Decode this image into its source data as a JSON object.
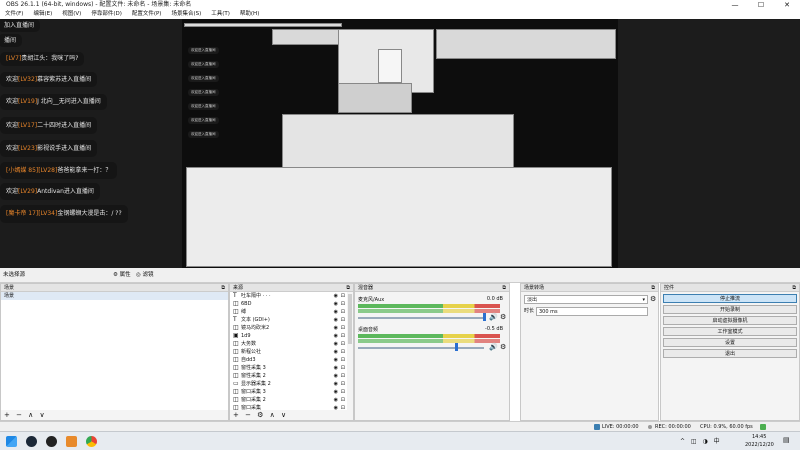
{
  "window": {
    "title": "OBS 26.1.1 (64-bit, windows) - 配置文件: 未命名 - 场景集: 未命名",
    "min": "—",
    "max": "☐",
    "close": "✕"
  },
  "menu": [
    "文件(F)",
    "编辑(E)",
    "视图(V)",
    "停靠部件(D)",
    "配置文件(P)",
    "场景集合(S)",
    "工具(T)",
    "帮助(H)"
  ],
  "chat": [
    {
      "pre": "",
      "lv": "",
      "post": "加入直播间"
    },
    {
      "pre": "",
      "lv": "",
      "post": "播间"
    },
    {
      "pre": "",
      "lv": "[LV7]",
      "post": "贵胡江头：我咪了吗?"
    },
    {
      "pre": "欢迎",
      "lv": "[LV32]",
      "post": "慕容紫苏进入直播间"
    },
    {
      "pre": "欢迎",
      "lv": "[LV19]",
      "post": "J 北向__无问进入直播间"
    },
    {
      "pre": "欢迎",
      "lv": "[LV17]",
      "post": "二十四时进入直播间"
    },
    {
      "pre": "欢迎",
      "lv": "[LV23]",
      "post": "影视说手进入直播间"
    },
    {
      "pre": "",
      "lv": "[小嫣媒 85][LV28]",
      "post": "爸爸能拿来一打：？"
    },
    {
      "pre": "欢迎",
      "lv": "[LV29]",
      "post": "Antdivan进入直播间"
    },
    {
      "pre": "",
      "lv": "[魔卡帝 17][LV34]",
      "post": "金钢螺蛳大漫是击：/ ??"
    }
  ],
  "scene_bar": {
    "label": "未选择源",
    "props": "⚙ 属性",
    "filters": "◎ 滤镜"
  },
  "docks": {
    "scenes": {
      "title": "场景",
      "pin": "⧉",
      "item": "场景",
      "footer": "+ − ∧ ∨"
    },
    "sources": {
      "title": "来源",
      "pin": "⧉",
      "footer": "+ − ⚙ ∧ ∨",
      "items": [
        {
          "icon": "T",
          "label": "吐车隔中 · · ·"
        },
        {
          "icon": "◫",
          "label": "6BD"
        },
        {
          "icon": "◫",
          "label": "缚"
        },
        {
          "icon": "T",
          "label": "文本 (GDI+)"
        },
        {
          "icon": "◫",
          "label": "镜马均砍米2"
        },
        {
          "icon": "▣",
          "label": "1d9"
        },
        {
          "icon": "◫",
          "label": "大务数"
        },
        {
          "icon": "◫",
          "label": "新程公社"
        },
        {
          "icon": "◫",
          "label": "自dd3"
        },
        {
          "icon": "◫",
          "label": "窗性采集 3"
        },
        {
          "icon": "◫",
          "label": "窗性采集 2"
        },
        {
          "icon": "▭",
          "label": "显示器采集 2"
        },
        {
          "icon": "◫",
          "label": "窗口采集 3"
        },
        {
          "icon": "◫",
          "label": "窗口采集 2"
        },
        {
          "icon": "◫",
          "label": "窗口采集"
        }
      ]
    },
    "mixer": {
      "title": "混音器",
      "pin": "⧉",
      "tracks": [
        {
          "name": "麦克风/Aux",
          "db": "0.0 dB"
        },
        {
          "name": "桌面音频",
          "db": "-0.5 dB"
        }
      ]
    },
    "transitions": {
      "title": "场景转场",
      "pin": "⧉",
      "selected": "淡出",
      "duration_label": "时长",
      "duration_value": "300 ms"
    },
    "controls": {
      "title": "控件",
      "pin": "⧉",
      "buttons": [
        "停止推流",
        "开始录制",
        "启动虚拟摄像机",
        "工作室模式",
        "设置",
        "退出"
      ]
    }
  },
  "status": {
    "live": "LIVE: 00:00:00",
    "rec": "REC: 00:00:00",
    "cpu": "CPU: 0.9%, 60.00 fps"
  },
  "taskbar": {
    "time": "14:45",
    "date": "2022/12/20",
    "tray": "^ ◫ ◑ 中",
    "notify": "▤"
  },
  "colors": {
    "accent": "#3c7fb1",
    "level_orange": "#e8852a",
    "meter_green": "#5cb85c"
  }
}
